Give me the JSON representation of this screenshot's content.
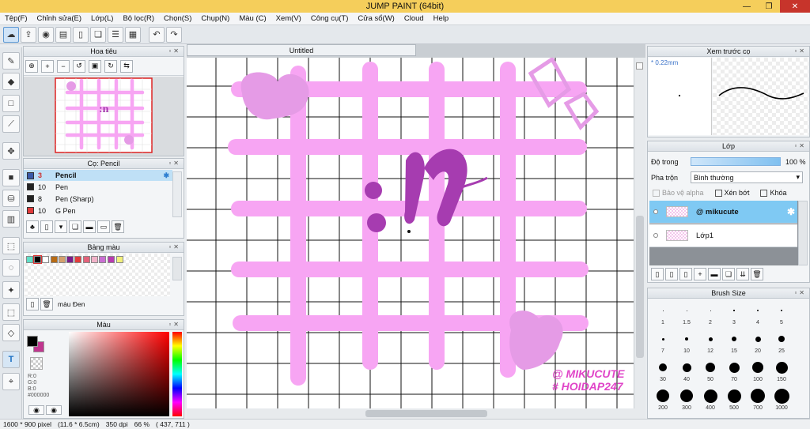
{
  "app": {
    "title": "JUMP PAINT (64bit)",
    "min": "—",
    "max": "❐",
    "close": "✕"
  },
  "menu": [
    "Tệp(F)",
    "Chỉnh sửa(E)",
    "Lớp(L)",
    "Bộ lọc(R)",
    "Chọn(S)",
    "Chụp(N)",
    "Màu (C)",
    "Xem(V)",
    "Công cụ(T)",
    "Cửa sổ(W)",
    "Cloud",
    "Help"
  ],
  "toolbar_icons": [
    "cloud-icon",
    "share-icon",
    "speech-icon",
    "comment-icon",
    "page-icon",
    "copy-icon",
    "grid-icon",
    "undo-icon",
    "redo-icon"
  ],
  "navigator": {
    "title": "Hoa tiêu"
  },
  "brush_panel": {
    "title": "Cọ: Pencil",
    "items": [
      {
        "size": "3",
        "name": "Pencil",
        "color": "#3a5aa8"
      },
      {
        "size": "10",
        "name": "Pen",
        "color": "#222222"
      },
      {
        "size": "8",
        "name": "Pen (Sharp)",
        "color": "#222222"
      },
      {
        "size": "10",
        "name": "G Pen",
        "color": "#e03a3a"
      }
    ]
  },
  "palette": {
    "title": "Bảng màu",
    "colors": [
      "#5fe0c8",
      "#000000",
      "#ffffff",
      "#b86b14",
      "#d4a06c",
      "#7a1d8a",
      "#e23c3c",
      "#e2627a",
      "#f1b2c8",
      "#c96fd2",
      "#b83ab0",
      "#f2f07a"
    ],
    "selected_label": "màu Đen"
  },
  "color_panel": {
    "title": "Màu",
    "r": "R:0",
    "g": "G:0",
    "b": "B:0",
    "hex": "#000000"
  },
  "document": {
    "tab": "Untitled"
  },
  "artwork": {
    "watermark1": "@ MIKUCUTE",
    "watermark2": "# HOIDAP247"
  },
  "preview": {
    "title": "Xem trước cọ",
    "size": "0.22mm"
  },
  "layers": {
    "title": "Lớp",
    "opacity_label": "Độ trong",
    "opacity_value": "100 %",
    "opacity": 1.0,
    "blend_label": "Pha trộn",
    "blend_value": "Bình thường",
    "protect_alpha": "Bảo vệ alpha",
    "clipping": "Xén bớt",
    "lock": "Khóa",
    "items": [
      {
        "name": "@ mikucute",
        "selected": true
      },
      {
        "name": "Lớp1",
        "selected": false
      }
    ]
  },
  "brush_size": {
    "title": "Brush Size",
    "sizes": [
      "1",
      "1.5",
      "2",
      "3",
      "4",
      "5",
      "7",
      "10",
      "12",
      "15",
      "20",
      "25",
      "30",
      "40",
      "50",
      "70",
      "100",
      "150",
      "200",
      "300",
      "400",
      "500",
      "700",
      "1000"
    ]
  },
  "status": {
    "pixels": "1600 * 900 pixel",
    "cm": "(11.6 * 6.5cm)",
    "dpi": "350 dpi",
    "zoom": "66 %",
    "coords": "( 437, 711 )"
  }
}
